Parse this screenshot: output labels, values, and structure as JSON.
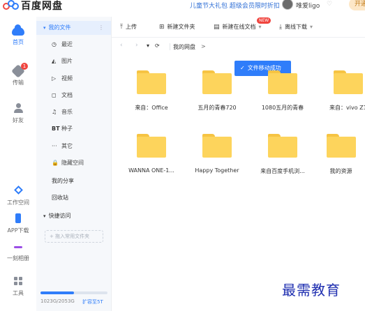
{
  "brand": {
    "name": "百度网盘"
  },
  "header": {
    "promo": "儿童节大礼包 超级会员限时折扣",
    "user_name": "唯爱ligo",
    "user_badge": "♡",
    "open_label": "开通"
  },
  "rail": {
    "items": [
      {
        "label": "首页",
        "icon": "cloud-icon"
      },
      {
        "label": "传输",
        "icon": "transfer-icon",
        "badge": "1"
      },
      {
        "label": "好友",
        "icon": "friends-icon"
      },
      {
        "label": "工作空间",
        "icon": "workspace-icon"
      },
      {
        "label": "APP下载",
        "icon": "phone-icon"
      },
      {
        "label": "一刻相册",
        "icon": "album-icon"
      },
      {
        "label": "工具",
        "icon": "tools-icon"
      }
    ]
  },
  "sidebar": {
    "my_files": "我的文件",
    "more": "⋮",
    "categories": [
      {
        "label": "最近",
        "glyph": "◷"
      },
      {
        "label": "图片",
        "glyph": "◭"
      },
      {
        "label": "视频",
        "glyph": "▷"
      },
      {
        "label": "文档",
        "glyph": "◻"
      },
      {
        "label": "音乐",
        "glyph": "♫"
      },
      {
        "label": "种子",
        "glyph": "BT"
      },
      {
        "label": "其它",
        "glyph": "···"
      },
      {
        "label": "隐藏空间",
        "glyph": "🔒"
      }
    ],
    "my_share": "我的分享",
    "recycle": "回收站",
    "quick_access": "快捷访问",
    "add_folder": "+ 拖入常用文件夹",
    "storage_text": "1023G/2053G",
    "storage_used_fraction": 0.498,
    "expand_label": "扩容至5T"
  },
  "toolbar": {
    "upload": "上传",
    "new_folder": "新建文件夹",
    "new_online_doc": "新建在线文档",
    "new_tag": "NEW",
    "offline_download": "离线下载"
  },
  "breadcrumb": {
    "back": "‹",
    "forward": "›",
    "dropdown": "▾",
    "refresh": "⟳",
    "path": "我的网盘",
    "arrow": ">"
  },
  "toast": {
    "text": "文件移动成功"
  },
  "files": [
    {
      "name": "来自：Office"
    },
    {
      "name": "五月的青春720"
    },
    {
      "name": "1080五月的青春"
    },
    {
      "name": "来自：vivo Z1"
    },
    {
      "name": "WANNA ONE-1..."
    },
    {
      "name": "Happy Together"
    },
    {
      "name": "来自百度手机浏..."
    },
    {
      "name": "我的资源"
    }
  ],
  "watermark": {
    "text": "最需教育"
  },
  "colors": {
    "accent": "#2f7dfa",
    "folder": "#fdd45c",
    "toast": "#2f7dfa",
    "badge": "#f0443e"
  }
}
